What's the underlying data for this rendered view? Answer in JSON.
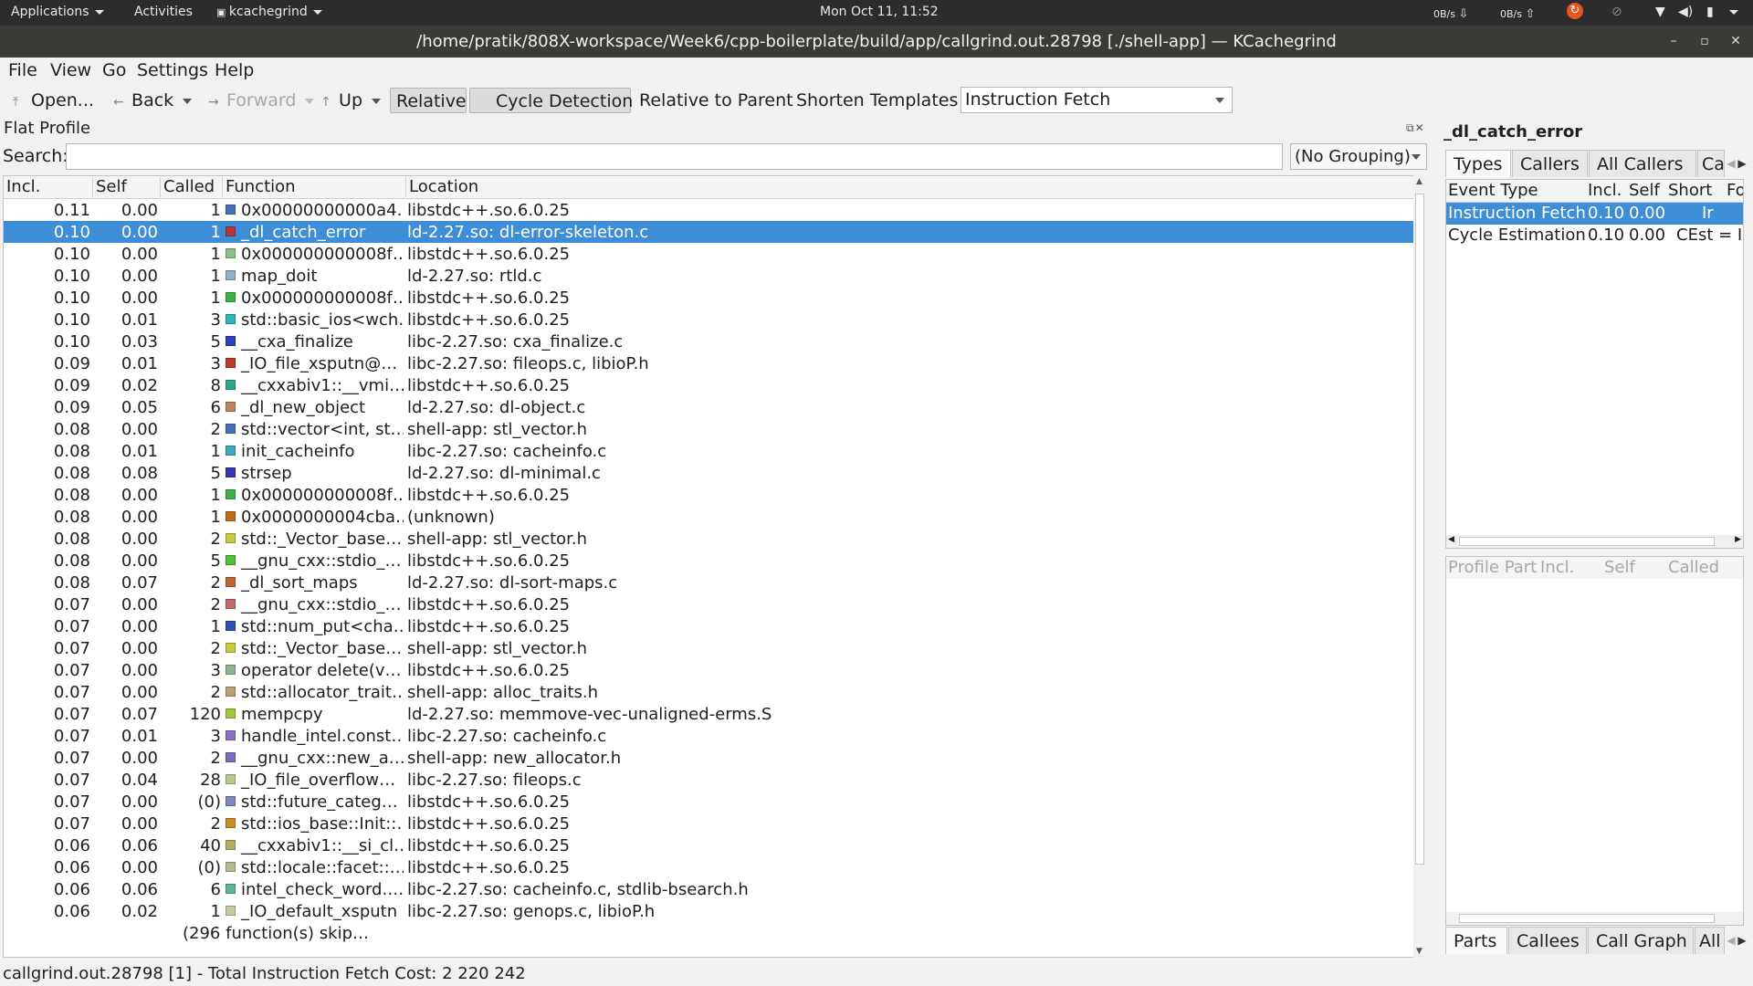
{
  "topbar": {
    "applications": "Applications",
    "activities": "Activities",
    "app_name": "kcachegrind",
    "clock": "Mon Oct 11, 11:52",
    "net_down": "0B/s",
    "net_up": "0B/s"
  },
  "window": {
    "title": "/home/pratik/808X-workspace/Week6/cpp-boilerplate/build/app/callgrind.out.28798 [./shell-app] — KCachegrind"
  },
  "menu": {
    "file": "File",
    "view": "View",
    "go": "Go",
    "settings": "Settings",
    "help": "Help"
  },
  "toolbar": {
    "open": "Open...",
    "back": "Back",
    "forward": "Forward",
    "up": "Up",
    "relative": "Relative",
    "cycle_detection": "Cycle Detection",
    "relative_to_parent": "Relative to Parent",
    "shorten_templates": "Shorten Templates",
    "event_type": "Instruction Fetch"
  },
  "flat_profile": {
    "title": "Flat Profile",
    "search_label": "Search:",
    "search_value": "",
    "grouping": "(No Grouping)",
    "columns": {
      "incl": "Incl.",
      "self": "Self",
      "called": "Called",
      "function": "Function",
      "location": "Location"
    },
    "rows": [
      {
        "incl": "0.11",
        "self": "0.00",
        "called": "1",
        "func": "0x00000000000a4…",
        "loc": "libstdc++.so.6.0.25",
        "color": "#4a6fbd"
      },
      {
        "incl": "0.10",
        "self": "0.00",
        "called": "1",
        "func": "_dl_catch_error",
        "loc": "ld-2.27.so: dl-error-skeleton.c",
        "color": "#b03a3a",
        "selected": true
      },
      {
        "incl": "0.10",
        "self": "0.00",
        "called": "1",
        "func": "0x000000000008f…",
        "loc": "libstdc++.so.6.0.25",
        "color": "#8dbf8d"
      },
      {
        "incl": "0.10",
        "self": "0.00",
        "called": "1",
        "func": "map_doit",
        "loc": "ld-2.27.so: rtld.c",
        "color": "#8fb2c8"
      },
      {
        "incl": "0.10",
        "self": "0.00",
        "called": "1",
        "func": "0x000000000008f…",
        "loc": "libstdc++.so.6.0.25",
        "color": "#3cb043"
      },
      {
        "incl": "0.10",
        "self": "0.01",
        "called": "3",
        "func": "std::basic_ios<wch…",
        "loc": "libstdc++.so.6.0.25",
        "color": "#2bb5b5"
      },
      {
        "incl": "0.10",
        "self": "0.03",
        "called": "5",
        "func": "__cxa_finalize",
        "loc": "libc-2.27.so: cxa_finalize.c",
        "color": "#2e3fbf"
      },
      {
        "incl": "0.09",
        "self": "0.01",
        "called": "3",
        "func": "_IO_file_xsputn@…",
        "loc": "libc-2.27.so: fileops.c, libioP.h",
        "color": "#c0392b"
      },
      {
        "incl": "0.09",
        "self": "0.02",
        "called": "8",
        "func": "__cxxabiv1::__vmi…",
        "loc": "libstdc++.so.6.0.25",
        "color": "#2fa88a"
      },
      {
        "incl": "0.09",
        "self": "0.05",
        "called": "6",
        "func": "_dl_new_object",
        "loc": "ld-2.27.so: dl-object.c",
        "color": "#c2855a"
      },
      {
        "incl": "0.08",
        "self": "0.00",
        "called": "2",
        "func": "std::vector<int, st…",
        "loc": "shell-app: stl_vector.h",
        "color": "#4a6fbd"
      },
      {
        "incl": "0.08",
        "self": "0.01",
        "called": "1",
        "func": "init_cacheinfo",
        "loc": "libc-2.27.so: cacheinfo.c",
        "color": "#3aa8c0"
      },
      {
        "incl": "0.08",
        "self": "0.08",
        "called": "5",
        "func": "strsep",
        "loc": "ld-2.27.so: dl-minimal.c",
        "color": "#3636b8"
      },
      {
        "incl": "0.08",
        "self": "0.00",
        "called": "1",
        "func": "0x000000000008f…",
        "loc": "libstdc++.so.6.0.25",
        "color": "#3cb043"
      },
      {
        "incl": "0.08",
        "self": "0.00",
        "called": "1",
        "func": "0x0000000004cba…",
        "loc": "(unknown)",
        "color": "#c06a1a"
      },
      {
        "incl": "0.08",
        "self": "0.00",
        "called": "2",
        "func": "std::_Vector_base…",
        "loc": "shell-app: stl_vector.h",
        "color": "#c8c840"
      },
      {
        "incl": "0.08",
        "self": "0.00",
        "called": "5",
        "func": "__gnu_cxx::stdio_…",
        "loc": "libstdc++.so.6.0.25",
        "color": "#52c23a"
      },
      {
        "incl": "0.08",
        "self": "0.07",
        "called": "2",
        "func": "_dl_sort_maps",
        "loc": "ld-2.27.so: dl-sort-maps.c",
        "color": "#c0682e"
      },
      {
        "incl": "0.07",
        "self": "0.00",
        "called": "2",
        "func": "__gnu_cxx::stdio_…",
        "loc": "libstdc++.so.6.0.25",
        "color": "#c46a6a"
      },
      {
        "incl": "0.07",
        "self": "0.00",
        "called": "1",
        "func": "std::num_put<cha…",
        "loc": "libstdc++.so.6.0.25",
        "color": "#2e50b8"
      },
      {
        "incl": "0.07",
        "self": "0.00",
        "called": "2",
        "func": "std::_Vector_base…",
        "loc": "shell-app: stl_vector.h",
        "color": "#c8c840"
      },
      {
        "incl": "0.07",
        "self": "0.00",
        "called": "3",
        "func": "operator delete(v…",
        "loc": "libstdc++.so.6.0.25",
        "color": "#8fb58f"
      },
      {
        "incl": "0.07",
        "self": "0.00",
        "called": "2",
        "func": "std::allocator_trait…",
        "loc": "shell-app: alloc_traits.h",
        "color": "#b8a070"
      },
      {
        "incl": "0.07",
        "self": "0.07",
        "called": "120",
        "func": "mempcpy",
        "loc": "ld-2.27.so: memmove-vec-unaligned-erms.S",
        "color": "#a0c83c"
      },
      {
        "incl": "0.07",
        "self": "0.01",
        "called": "3",
        "func": "handle_intel.const…",
        "loc": "libc-2.27.so: cacheinfo.c",
        "color": "#8870c8"
      },
      {
        "incl": "0.07",
        "self": "0.00",
        "called": "2",
        "func": "__gnu_cxx::new_a…",
        "loc": "shell-app: new_allocator.h",
        "color": "#7c6ac0"
      },
      {
        "incl": "0.07",
        "self": "0.04",
        "called": "28",
        "func": "_IO_file_overflow…",
        "loc": "libc-2.27.so: fileops.c",
        "color": "#b8c890"
      },
      {
        "incl": "0.07",
        "self": "0.00",
        "called": "(0)",
        "func": "std::future_categ…",
        "loc": "libstdc++.so.6.0.25",
        "color": "#7a8ac0"
      },
      {
        "incl": "0.07",
        "self": "0.00",
        "called": "2",
        "func": "std::ios_base::Init::…",
        "loc": "libstdc++.so.6.0.25",
        "color": "#c89020"
      },
      {
        "incl": "0.06",
        "self": "0.06",
        "called": "40",
        "func": "__cxxabiv1::__si_cl…",
        "loc": "libstdc++.so.6.0.25",
        "color": "#b0b060"
      },
      {
        "incl": "0.06",
        "self": "0.00",
        "called": "(0)",
        "func": "std::locale::facet::…",
        "loc": "libstdc++.so.6.0.25",
        "color": "#b8b890"
      },
      {
        "incl": "0.06",
        "self": "0.06",
        "called": "6",
        "func": "intel_check_word.…",
        "loc": "libc-2.27.so: cacheinfo.c, stdlib-bsearch.h",
        "color": "#5ab89a"
      },
      {
        "incl": "0.06",
        "self": "0.02",
        "called": "1",
        "func": "_IO_default_xsputn",
        "loc": "libc-2.27.so: genops.c, libioP.h",
        "color": "#c8c8a0"
      }
    ],
    "skipped_note": "(296 function(s) skip…"
  },
  "status": "callgrind.out.28798 [1] - Total Instruction Fetch Cost: 2 220 242",
  "detail": {
    "function_name": "_dl_catch_error",
    "top_tabs": [
      "Types",
      "Callers",
      "All Callers",
      "Ca"
    ],
    "types_columns": {
      "event_type": "Event Type",
      "incl": "Incl.",
      "self": "Self",
      "short": "Short",
      "formula": "Fo"
    },
    "types_rows": [
      {
        "event": "Instruction Fetch",
        "incl": "0.10",
        "self": "0.00",
        "short": "Ir",
        "selected": true
      },
      {
        "event": "Cycle Estimation",
        "incl": "0.10",
        "self": "0.00",
        "short": "CEst = Ir"
      }
    ],
    "parts_columns": {
      "part": "Profile Part",
      "incl": "Incl.",
      "self": "Self",
      "called": "Called"
    },
    "bottom_tabs": [
      "Parts",
      "Callees",
      "Call Graph",
      "All"
    ]
  }
}
